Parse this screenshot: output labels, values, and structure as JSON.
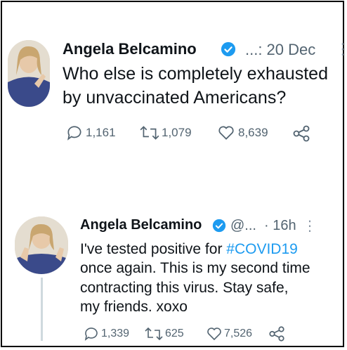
{
  "tweets": [
    {
      "name": "Angela Belcamino",
      "handle": "...: 20 Dec",
      "more": "⋮",
      "text": "Who else is completely exhausted by unvaccinated Americans?",
      "line1": "Who else is completely exhausted",
      "line2": "by unvaccinated Americans?",
      "replies": "1,161",
      "retweets": "1,079",
      "likes": "8,639"
    },
    {
      "name": "Angela Belcamino",
      "handle": "@...",
      "time": "· 16h",
      "more": "⋮",
      "text_prefix": "I've tested positive for ",
      "hashtag": "#COVID19",
      "line2": "once again. This is my second time",
      "line3": "contracting this virus. Stay safe,",
      "line4": "my friends. xoxo",
      "replies": "1,339",
      "retweets": "625",
      "likes": "7,526"
    }
  ],
  "colors": {
    "accent": "#1d9bf0",
    "secondary": "#536471",
    "verified": "#1d9bf0"
  },
  "icons": [
    "verified-badge-icon",
    "reply-icon",
    "retweet-icon",
    "like-icon",
    "share-icon",
    "more-icon"
  ]
}
